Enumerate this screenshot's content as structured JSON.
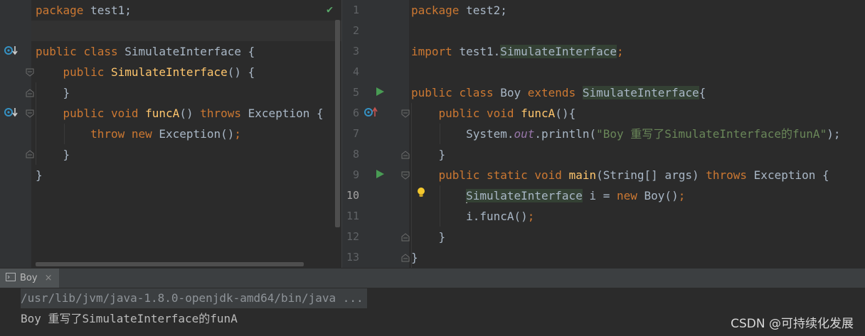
{
  "left_editor": {
    "lines": [
      {
        "tokens": [
          {
            "t": "package ",
            "c": "kw"
          },
          {
            "t": "test1;",
            "c": ""
          }
        ]
      },
      {
        "tokens": []
      },
      {
        "tokens": [
          {
            "t": "public ",
            "c": "kw"
          },
          {
            "t": "class ",
            "c": "kw"
          },
          {
            "t": "SimulateInterface {",
            "c": ""
          }
        ]
      },
      {
        "tokens": [
          {
            "t": "    public ",
            "c": "kw"
          },
          {
            "t": "SimulateInterface",
            "c": "fn"
          },
          {
            "t": "() {",
            "c": ""
          }
        ]
      },
      {
        "tokens": [
          {
            "t": "    }",
            "c": ""
          }
        ]
      },
      {
        "tokens": [
          {
            "t": "    public ",
            "c": "kw"
          },
          {
            "t": "void ",
            "c": "kw"
          },
          {
            "t": "funcA",
            "c": "fn"
          },
          {
            "t": "() ",
            "c": ""
          },
          {
            "t": "throws ",
            "c": "kw"
          },
          {
            "t": "Exception {",
            "c": ""
          }
        ]
      },
      {
        "tokens": [
          {
            "t": "        throw ",
            "c": "kw"
          },
          {
            "t": "new ",
            "c": "kw"
          },
          {
            "t": "Exception()",
            "c": ""
          },
          {
            "t": ";",
            "c": "kw"
          }
        ]
      },
      {
        "tokens": [
          {
            "t": "    }",
            "c": ""
          }
        ]
      },
      {
        "tokens": [
          {
            "t": "}",
            "c": ""
          }
        ]
      }
    ]
  },
  "right_editor": {
    "current_line": 10,
    "lines": [
      {
        "n": "1",
        "tokens": [
          {
            "t": "package ",
            "c": "kw"
          },
          {
            "t": "test2;",
            "c": ""
          }
        ]
      },
      {
        "n": "2",
        "tokens": []
      },
      {
        "n": "3",
        "tokens": [
          {
            "t": "import ",
            "c": "kw"
          },
          {
            "t": "test1.",
            "c": ""
          },
          {
            "t": "SimulateInterface",
            "c": "usage"
          },
          {
            "t": ";",
            "c": "kw"
          }
        ]
      },
      {
        "n": "4",
        "tokens": []
      },
      {
        "n": "5",
        "tokens": [
          {
            "t": "public ",
            "c": "kw"
          },
          {
            "t": "class ",
            "c": "kw"
          },
          {
            "t": "Boy ",
            "c": ""
          },
          {
            "t": "extends ",
            "c": "kw"
          },
          {
            "t": "SimulateInterface",
            "c": "usage"
          },
          {
            "t": "{",
            "c": ""
          }
        ]
      },
      {
        "n": "6",
        "tokens": [
          {
            "t": "    public ",
            "c": "kw"
          },
          {
            "t": "void ",
            "c": "kw"
          },
          {
            "t": "funcA",
            "c": "fn"
          },
          {
            "t": "(){",
            "c": ""
          }
        ]
      },
      {
        "n": "7",
        "tokens": [
          {
            "t": "        System.",
            "c": ""
          },
          {
            "t": "out",
            "c": "stat"
          },
          {
            "t": ".println(",
            "c": ""
          },
          {
            "t": "\"Boy 重写了SimulateInterface的funA\"",
            "c": "str"
          },
          {
            "t": ");",
            "c": ""
          }
        ]
      },
      {
        "n": "8",
        "tokens": [
          {
            "t": "    }",
            "c": ""
          }
        ]
      },
      {
        "n": "9",
        "tokens": [
          {
            "t": "    public ",
            "c": "kw"
          },
          {
            "t": "static ",
            "c": "kw"
          },
          {
            "t": "void ",
            "c": "kw"
          },
          {
            "t": "main",
            "c": "fn"
          },
          {
            "t": "(String[] args) ",
            "c": ""
          },
          {
            "t": "throws ",
            "c": "kw"
          },
          {
            "t": "Exception {",
            "c": ""
          }
        ]
      },
      {
        "n": "10",
        "tokens": [
          {
            "t": "        ",
            "c": ""
          },
          {
            "t": "SimulateInterface",
            "c": "usage"
          },
          {
            "t": " i = ",
            "c": ""
          },
          {
            "t": "new ",
            "c": "kw"
          },
          {
            "t": "Boy()",
            "c": ""
          },
          {
            "t": ";",
            "c": "kw"
          }
        ]
      },
      {
        "n": "11",
        "tokens": [
          {
            "t": "        i.funcA()",
            "c": ""
          },
          {
            "t": ";",
            "c": "kw"
          }
        ]
      },
      {
        "n": "12",
        "tokens": [
          {
            "t": "    }",
            "c": ""
          }
        ]
      },
      {
        "n": "13",
        "tokens": [
          {
            "t": "}",
            "c": ""
          }
        ]
      }
    ]
  },
  "run_panel": {
    "tab_label": "Boy",
    "tab_close": "×",
    "command": "/usr/lib/jvm/java-1.8.0-openjdk-amd64/bin/java ...",
    "output": "Boy 重写了SimulateInterface的funA"
  },
  "watermark": "CSDN @可持续化发展",
  "icons": {
    "check": "check-icon",
    "run": "run-gutter-icon",
    "override": "overridden-method-icon",
    "implements": "overriding-method-icon",
    "bulb": "intention-bulb-icon"
  },
  "colors": {
    "background": "#2b2b2b",
    "keyword": "#cc7832",
    "function": "#ffc66d",
    "string": "#6a8759",
    "static": "#9876aa",
    "run_green": "#499c54"
  }
}
